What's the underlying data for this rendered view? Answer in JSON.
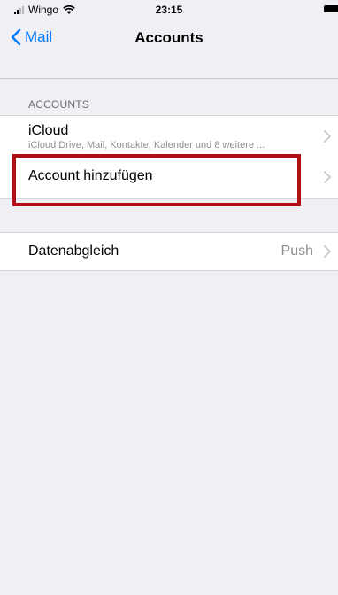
{
  "status_bar": {
    "carrier": "Wingo",
    "time": "23:15"
  },
  "nav": {
    "back_label": "Mail",
    "title": "Accounts"
  },
  "accounts_section": {
    "header": "ACCOUNTS",
    "items": [
      {
        "title": "iCloud",
        "subtitle": "iCloud Drive, Mail, Kontakte, Kalender und 8 weitere ..."
      },
      {
        "title": "Account hinzufügen"
      }
    ]
  },
  "sync_section": {
    "title": "Datenabgleich",
    "value": "Push"
  },
  "annotation": {
    "highlight_color": "#b10f14"
  }
}
